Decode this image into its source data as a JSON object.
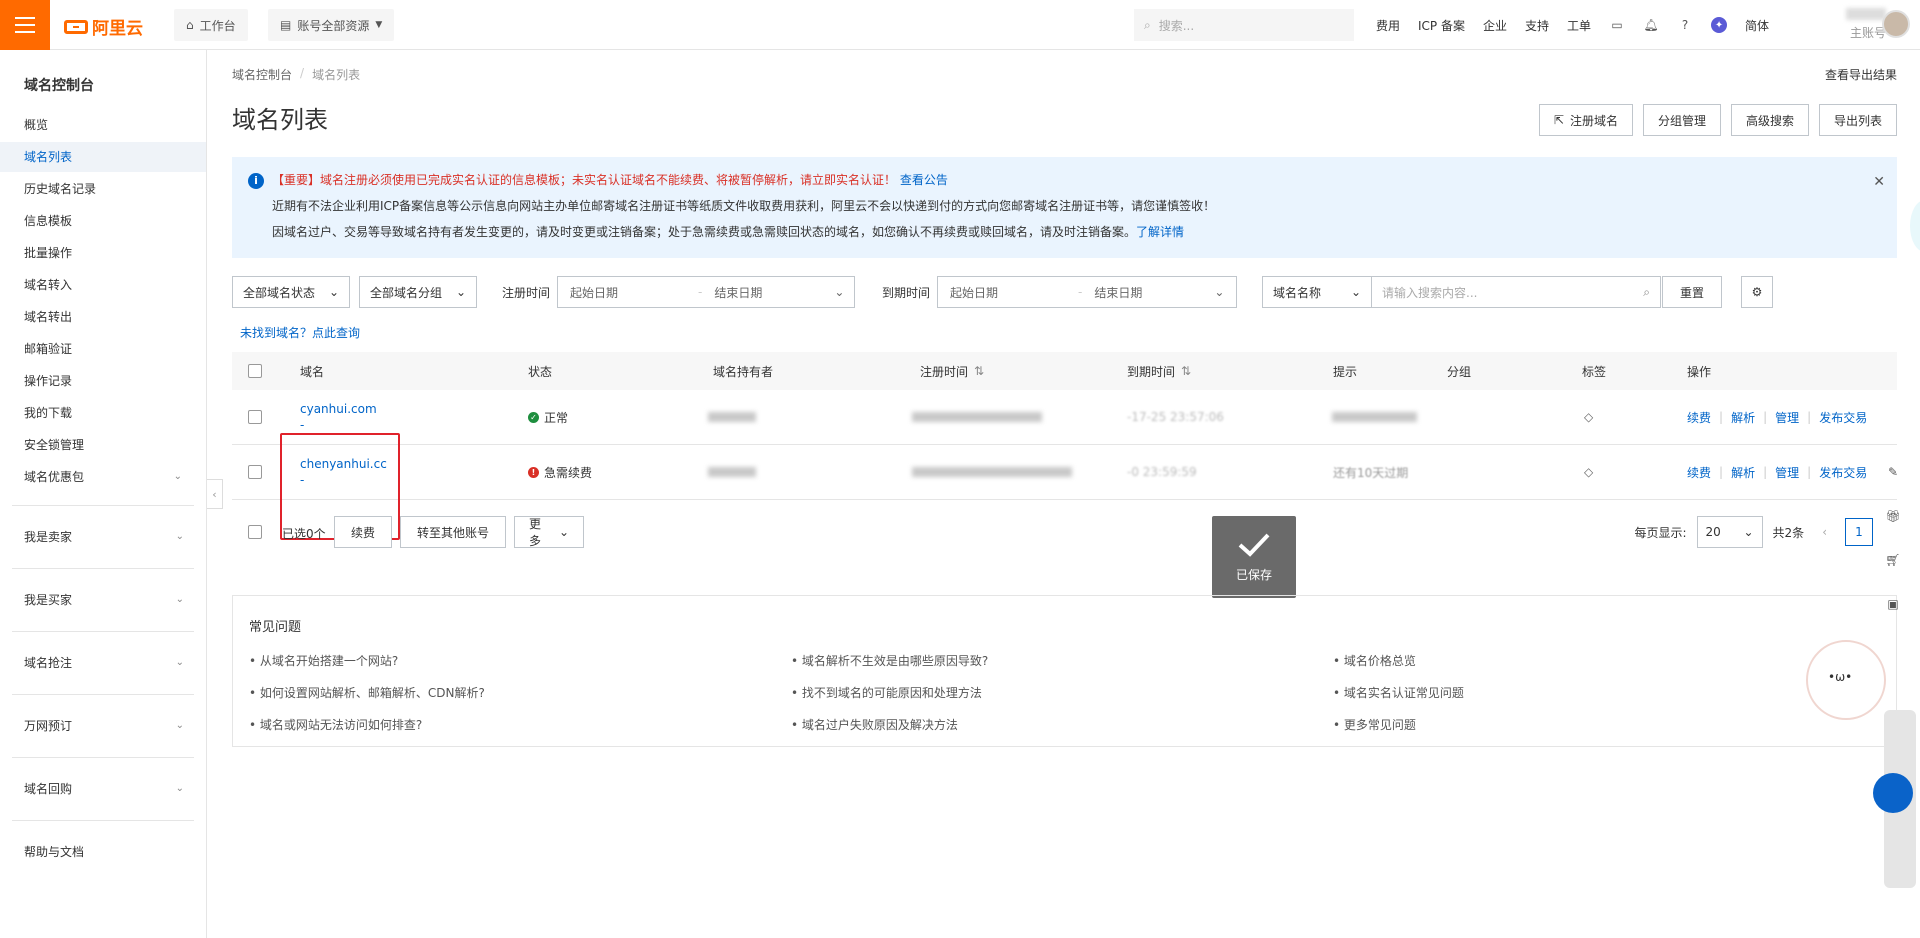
{
  "topbar": {
    "logo": "阿里云",
    "workbench": "工作台",
    "resources": "账号全部资源",
    "search_placeholder": "搜索...",
    "links": [
      "费用",
      "ICP 备案",
      "企业",
      "支持",
      "工单"
    ],
    "language": "简体",
    "account_label": "主账号"
  },
  "sidebar": {
    "title": "域名控制台",
    "items": [
      "概览",
      "域名列表",
      "历史域名记录",
      "信息模板",
      "批量操作",
      "域名转入",
      "域名转出",
      "邮箱验证",
      "操作记录",
      "我的下载",
      "安全锁管理",
      "域名优惠包"
    ],
    "groups": [
      "我是卖家",
      "我是买家",
      "域名抢注",
      "万网预订",
      "域名回购"
    ],
    "help": "帮助与文档"
  },
  "breadcrumb": [
    "域名控制台",
    "域名列表"
  ],
  "page": {
    "title": "域名列表",
    "export_result": "查看导出结果",
    "buttons": [
      "注册域名",
      "分组管理",
      "高级搜索",
      "导出列表"
    ]
  },
  "notice": {
    "tag": "【重要】",
    "line1": "域名注册必须使用已完成实名认证的信息模板；未实名认证域名不能续费、将被暂停解析，请立即实名认证！",
    "line1_link": "查看公告",
    "line2": "近期有不法企业利用ICP备案信息等公示信息向网站主办单位邮寄域名注册证书等纸质文件收取费用获利，阿里云不会以快递到付的方式向您邮寄域名注册证书等，请您谨慎签收！",
    "line3": "因域名过户、交易等导致域名持有者发生变更的，请及时变更或注销备案；处于急需续费或急需赎回状态的域名，如您确认不再续费或赎回域名，请及时注销备案。",
    "line3_link": "了解详情"
  },
  "filter": {
    "status": "全部域名状态",
    "group": "全部域名分组",
    "reg_time_label": "注册时间",
    "exp_time_label": "到期时间",
    "start_placeholder": "起始日期",
    "end_placeholder": "结束日期",
    "field": "域名名称",
    "search_placeholder": "请输入搜索内容...",
    "reset": "重置"
  },
  "notfound": "未找到域名？点此查询",
  "table": {
    "headers": [
      "域名",
      "状态",
      "域名持有者",
      "注册时间",
      "到期时间",
      "提示",
      "分组",
      "标签",
      "操作"
    ],
    "rows": [
      {
        "domain": "cyanhui.com",
        "suffix": "-",
        "status": "正常",
        "status_type": "ok",
        "expire": "-17-25 23:57:06",
        "hint": ""
      },
      {
        "domain": "chenyanhui.cc",
        "suffix": "-",
        "status": "急需续费",
        "status_type": "error",
        "expire": "-0 23:59:59",
        "hint": "还有10天过期"
      }
    ],
    "ops": [
      "续费",
      "解析",
      "管理",
      "发布交易"
    ]
  },
  "bulk": {
    "selected": "已选0个",
    "renew": "续费",
    "transfer": "转至其他账号",
    "more": "更多"
  },
  "pager": {
    "per_page_label": "每页显示:",
    "per_page": "20",
    "total": "共2条",
    "current": "1"
  },
  "toast": "已保存",
  "faq": {
    "title": "常见问题",
    "items": [
      "从域名开始搭建一个网站?",
      "如何设置网站解析、邮箱解析、CDN解析?",
      "域名或网站无法访问如何排查?",
      "域名解析不生效是由哪些原因导致?",
      "找不到域名的可能原因和处理方法",
      "域名过户失败原因及解决方法",
      "域名价格总览",
      "域名实名认证常见问题",
      "更多常见问题"
    ]
  },
  "colors": {
    "brand": "#ff6a00",
    "link": "#0064c8",
    "danger": "#d93026",
    "ok": "#1e8e3e"
  }
}
